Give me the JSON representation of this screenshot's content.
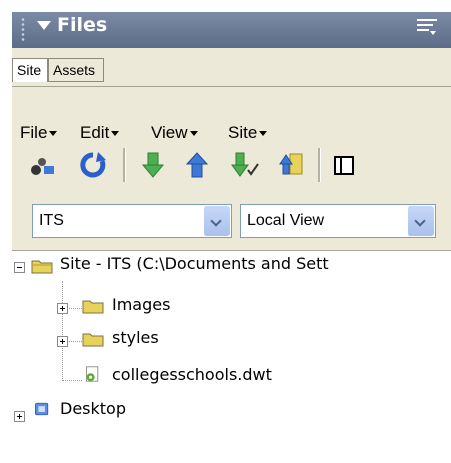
{
  "panel": {
    "title": "Files",
    "tabs": [
      {
        "label": "Site",
        "active": true
      },
      {
        "label": "Assets",
        "active": false
      }
    ],
    "menus": [
      {
        "label": "File"
      },
      {
        "label": "Edit"
      },
      {
        "label": "View"
      },
      {
        "label": "Site"
      }
    ],
    "toolbar": {
      "icons": [
        "connect-icon",
        "refresh-icon",
        "get-files-icon",
        "put-files-icon",
        "check-out-icon",
        "check-in-icon",
        "expand-icon"
      ]
    },
    "site_select": {
      "value": "ITS"
    },
    "view_select": {
      "value": "Local View"
    }
  },
  "tree": {
    "root_label": "Site - ITS (C:\\Documents and Sett",
    "children": [
      {
        "label": "Images",
        "type": "folder"
      },
      {
        "label": "styles",
        "type": "folder"
      },
      {
        "label": "collegesschools.dwt",
        "type": "file"
      }
    ],
    "desktop_label": "Desktop"
  },
  "colors": {
    "titlebar": "#5d6c87",
    "panel_bg": "#ece9d8",
    "tree_bg": "#ffffff",
    "folder": "#e7d25b",
    "accent_blue": "#2b5fc9"
  }
}
